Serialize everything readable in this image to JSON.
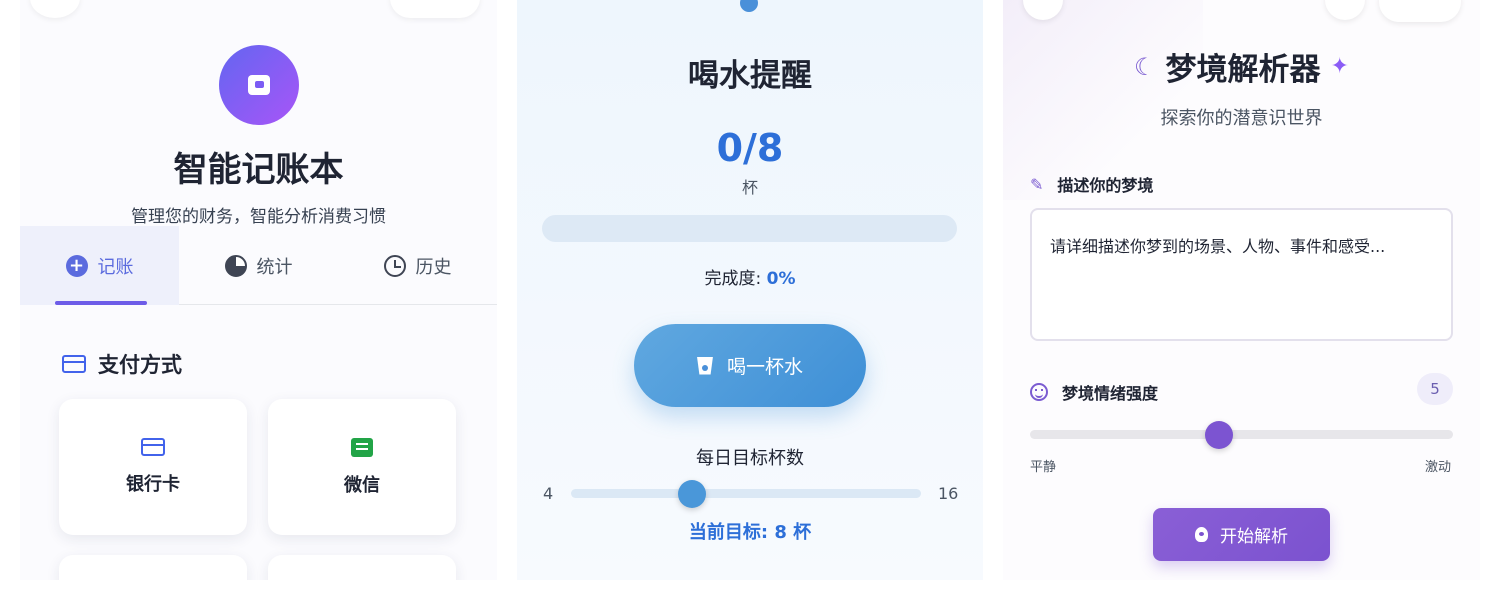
{
  "ledger": {
    "title": "智能记账本",
    "subtitle": "管理您的财务，智能分析消费习惯",
    "logo_icon": "wallet-icon",
    "accent": "#6d5ce8",
    "tabs": [
      {
        "label": "记账",
        "icon": "plus-circle-icon",
        "active": true
      },
      {
        "label": "统计",
        "icon": "pie-chart-icon",
        "active": false
      },
      {
        "label": "历史",
        "icon": "history-icon",
        "active": false
      }
    ],
    "section_title": "支付方式",
    "section_icon": "credit-card-icon",
    "payment_methods": [
      {
        "label": "银行卡",
        "icon": "credit-card-icon"
      },
      {
        "label": "微信",
        "icon": "wechat-icon"
      }
    ]
  },
  "water": {
    "title": "喝水提醒",
    "count": "0/8",
    "unit": "杯",
    "progress": 0,
    "completion_label": "完成度: ",
    "completion_value": "0%",
    "drink_button": "喝一杯水",
    "goal_label": "每日目标杯数",
    "goal_min": "4",
    "goal_max": "16",
    "goal_value": 8,
    "current_goal": "当前目标: 8 杯",
    "accent": "#2d6fd8"
  },
  "dream": {
    "title": "梦境解析器",
    "subtitle": "探索你的潜意识世界",
    "describe_label": "描述你的梦境",
    "describe_placeholder": "请详细描述你梦到的场景、人物、事件和感受...",
    "intensity_label": "梦境情绪强度",
    "intensity_value": "5",
    "intensity_min_label": "平静",
    "intensity_max_label": "激动",
    "analyze_button": "开始解析",
    "accent": "#7b52cf"
  }
}
